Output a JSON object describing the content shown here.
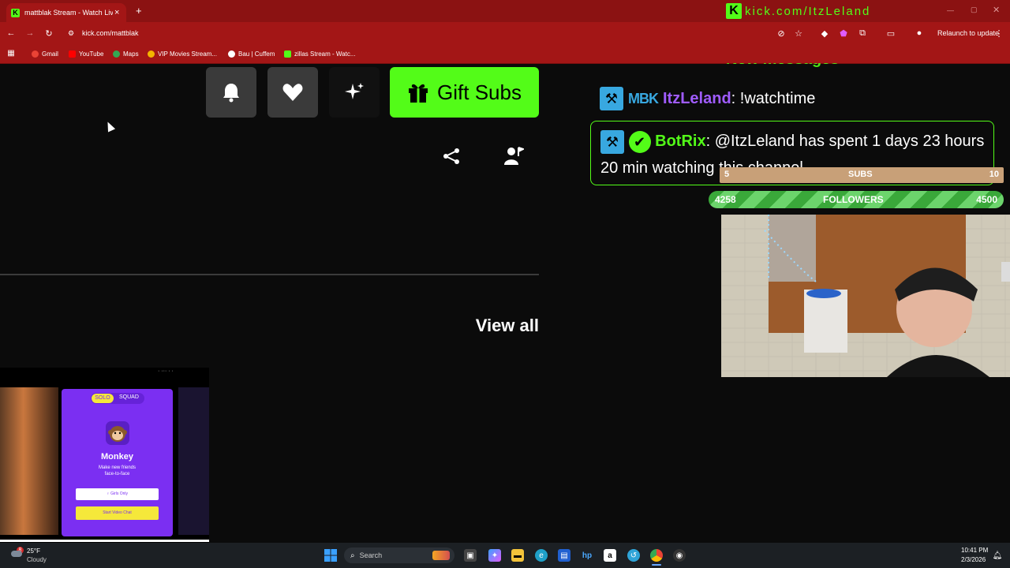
{
  "browser": {
    "tab_title": "mattblak Stream - Watch Live c",
    "tab_close": "×",
    "new_tab": "+",
    "url": "kick.com/mattblak",
    "relaunch_label": "Relaunch to update",
    "bookmarks": [
      {
        "label": "Gmail",
        "color": "#ea4335"
      },
      {
        "label": "YouTube",
        "color": "#ff0000"
      },
      {
        "label": "Maps",
        "color": "#34a853"
      },
      {
        "label": "VIP Movies Stream...",
        "color": "#f4b400"
      },
      {
        "label": "Bau | Cuffem",
        "color": "#ffffff"
      },
      {
        "label": "zillas Stream - Watc...",
        "color": "#53fc18"
      }
    ]
  },
  "page": {
    "gift_label": "Gift Subs",
    "view_all": "View all"
  },
  "overlay": {
    "banner_text": "kick.com/ItzLeland",
    "new_messages": "New messages",
    "chat": [
      {
        "badge": "MBK",
        "user": "ItzLeland",
        "text": ": !watchtime",
        "user_color": "#a05cff"
      },
      {
        "user": "BotRix",
        "text": ": @ItzLeland has spent 1 days 23 hours 20 min watching this channel.",
        "user_color": "#53fc18"
      }
    ],
    "subs": {
      "label": "SUBS",
      "current": "5",
      "goal": "10"
    },
    "followers": {
      "label": "FOLLOWERS",
      "current": "4258",
      "goal": "4500"
    }
  },
  "monkey_card": {
    "tab_solo": "SOLO",
    "tab_squad": "SQUAD",
    "title": "Monkey",
    "subtitle_1": "Make new friends",
    "subtitle_2": "face-to-face",
    "filter_button": "♀ Girls Only",
    "start_button": "Start Video Chat"
  },
  "taskbar": {
    "weather_badge": "8",
    "temperature": "25°F",
    "condition": "Cloudy",
    "search_label": "Search",
    "time": "10:41 PM",
    "date": "2/3/2026"
  },
  "colors": {
    "kick_green": "#53fc18",
    "chrome_red": "#a31616"
  }
}
